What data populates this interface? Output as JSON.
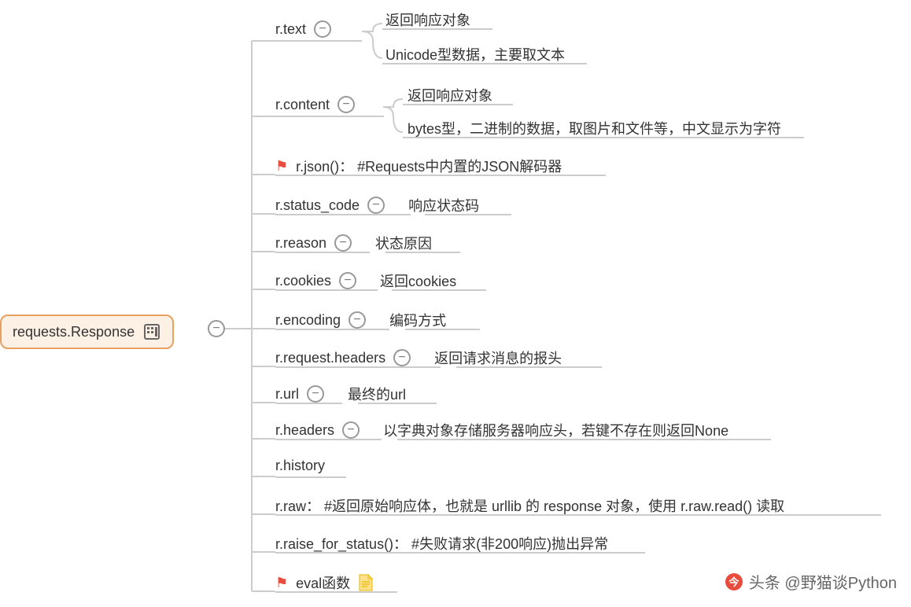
{
  "root": {
    "label": "requests.Response"
  },
  "nodes": [
    {
      "label": "r.text",
      "collapse": true,
      "children": [
        "返回响应对象",
        "Unicode型数据，主要取文本"
      ]
    },
    {
      "label": "r.content",
      "collapse": true,
      "children": [
        "返回响应对象",
        "bytes型，二进制的数据，取图片和文件等，中文显示为字符"
      ]
    },
    {
      "flag": true,
      "label": "r.json()： #Requests中内置的JSON解码器"
    },
    {
      "label": "r.status_code",
      "collapse": true,
      "inline": "响应状态码"
    },
    {
      "label": "r.reason",
      "collapse": true,
      "inline": "状态原因"
    },
    {
      "label": "r.cookies",
      "collapse": true,
      "inline": "返回cookies"
    },
    {
      "label": "r.encoding",
      "collapse": true,
      "inline": "编码方式"
    },
    {
      "label": "r.request.headers",
      "collapse": true,
      "inline": "返回请求消息的报头"
    },
    {
      "label": "r.url",
      "collapse": true,
      "inline": "最终的url"
    },
    {
      "label": "r.headers",
      "collapse": true,
      "inline": "以字典对象存储服务器响应头，若键不存在则返回None"
    },
    {
      "label": "r.history"
    },
    {
      "label": "r.raw： #返回原始响应体，也就是 urllib 的 response 对象，使用 r.raw.read() 读取"
    },
    {
      "label": "r.raise_for_status()： #失败请求(非200响应)抛出异常"
    },
    {
      "flag": true,
      "label": "eval函数",
      "doc": true
    }
  ],
  "watermark": "头条 @野猫谈Python"
}
